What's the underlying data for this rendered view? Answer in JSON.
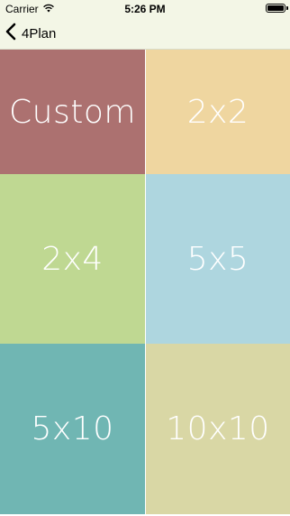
{
  "status_bar": {
    "carrier": "Carrier",
    "time": "5:26 PM",
    "wifi_icon": "wifi-icon",
    "battery_icon": "battery-icon"
  },
  "nav": {
    "back_label": "4Plan",
    "back_icon": "chevron-left-icon"
  },
  "tiles": [
    {
      "label": "Custom",
      "color": "#ac7170"
    },
    {
      "label": "2x2",
      "color": "#efd6a0"
    },
    {
      "label": "2x4",
      "color": "#bfd892"
    },
    {
      "label": "5x5",
      "color": "#aed6df"
    },
    {
      "label": "5x10",
      "color": "#70b6b3"
    },
    {
      "label": "10x10",
      "color": "#d9d7a5"
    }
  ]
}
